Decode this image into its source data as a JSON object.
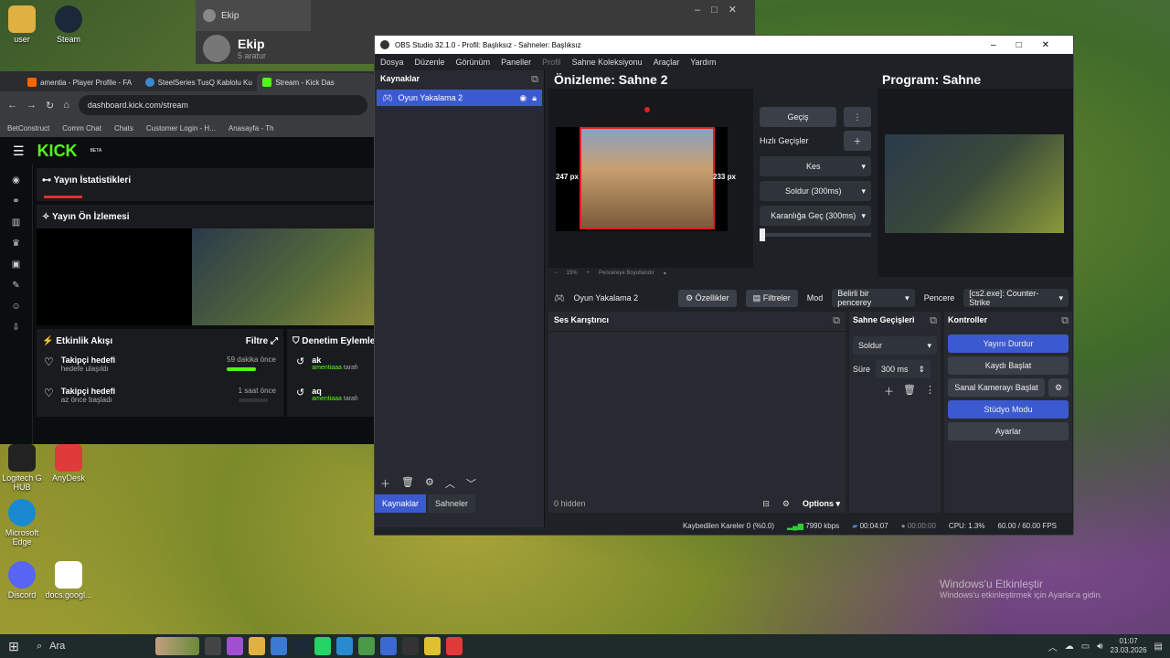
{
  "desktop": {
    "icons": [
      {
        "label": "user",
        "color": "#e0b040"
      },
      {
        "label": "Steam",
        "color": "#1b2838"
      },
      {
        "label": "Logitech G HUB",
        "color": "#222"
      },
      {
        "label": "AnyDesk",
        "color": "#e03a3a"
      },
      {
        "label": "Microsoft Edge",
        "color": "#1a8ad0"
      },
      {
        "label": "Discord",
        "color": "#5865f2"
      },
      {
        "label": "docs.googl...",
        "color": "#fff"
      }
    ],
    "watermark_title": "Windows'u Etkinleştir",
    "watermark_sub": "Windows'u etkinleştirmek için Ayarlar'a gidin."
  },
  "ekip": {
    "tab": "Ekip",
    "title": "Ekip",
    "sub": "5 aratur"
  },
  "browser": {
    "tabs": [
      "amentia - Player Profile - FA",
      "SteelSeries TusQ Kablolu Ku",
      "Stream - Kick Das"
    ],
    "url": "dashboard.kick.com/stream",
    "bookmarks": [
      "BetConstruct",
      "Comm Chat",
      "Chats",
      "Customer Login - H...",
      "Anasayfa - Th"
    ],
    "logo": "KICK",
    "logo_badge": "BETA",
    "stats_title": "Yayın İstatistikleri",
    "preview_title": "Yayın Ön İzlemesi",
    "activity_title": "Etkinlik Akışı",
    "filter": "Filtre",
    "moderation_title": "Denetim Eylemle",
    "events": [
      {
        "title": "Takipçi hedefi",
        "sub": "hedefe ulaşıldı",
        "time": "59 dakika önce",
        "progress": 1.0
      },
      {
        "title": "Takipçi hedefi",
        "sub": "az önce başladı",
        "time": "1 saat önce",
        "progress": 0.0
      }
    ],
    "mod": [
      {
        "name": "ak",
        "by": "amentiaaa",
        "action": "tarafı"
      },
      {
        "name": "aq",
        "by": "amentiaaa",
        "action": "tarafı"
      }
    ]
  },
  "obs": {
    "title": "OBS Studio 32.1.0 - Profil: Başlıksız - Sahneler: Başlıksız",
    "menu": [
      "Dosya",
      "Düzenle",
      "Görünüm",
      "Paneller",
      "Profil",
      "Sahne Koleksiyonu",
      "Araçlar",
      "Yardım"
    ],
    "sources_title": "Kaynaklar",
    "source_item": "Oyun Yakalama 2",
    "preview_title": "Önizleme: Sahne 2",
    "program_title": "Program: Sahne",
    "left_px": "247 px",
    "right_px": "233 px",
    "zoom": "15%",
    "fit": "Pencereye Boyutlandır",
    "transition": {
      "gecis": "Geçiş",
      "quick": "Hızlı Geçişler",
      "items": [
        "Kes",
        "Soldur (300ms)",
        "Karanlığa Geç (300ms)"
      ]
    },
    "src_bar": {
      "name": "Oyun Yakalama 2",
      "props": "Özellikler",
      "filters": "Filtreler",
      "mode_label": "Mod",
      "mode": "Belirli bir pencerey",
      "window_label": "Pencere",
      "window": "[cs2.exe]: Counter-Strike"
    },
    "mixer_title": "Ses Karıştırıcı",
    "hidden": "0 hidden",
    "options": "Options",
    "trans_title": "Sahne Geçişleri",
    "trans_sel": "Soldur",
    "duration_label": "Süre",
    "duration": "300 ms",
    "controls_title": "Kontroller",
    "controls": [
      "Yayını Durdur",
      "Kaydı Başlat",
      "Sanal Kamerayı Başlat",
      "Stüdyo Modu",
      "Ayarlar"
    ],
    "bottom_tabs": [
      "Kaynaklar",
      "Sahneler"
    ],
    "status": {
      "dropped": "Kaybedilen Kareler 0 (%0.0)",
      "bitrate": "7990 kbps",
      "stream_time": "00:04:07",
      "rec_time": "00:00:00",
      "cpu": "CPU: 1.3%",
      "fps": "60.00 / 60.00 FPS"
    }
  },
  "taskbar": {
    "search": "Ara",
    "time": "01:07",
    "date": "23.03.2026"
  }
}
